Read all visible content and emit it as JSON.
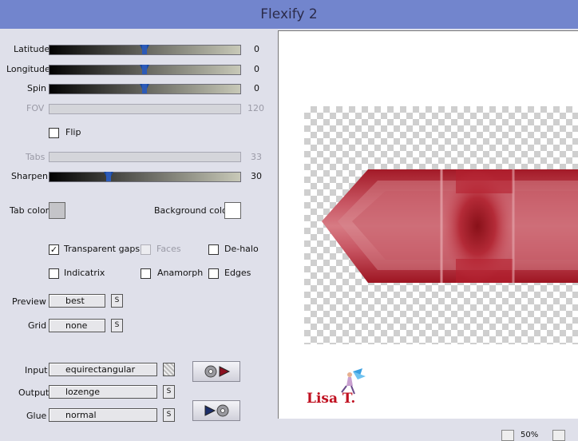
{
  "window": {
    "title": "Flexify 2"
  },
  "sliders": {
    "latitude": {
      "label": "Latitude",
      "value": "0",
      "position": 0.5
    },
    "longitude": {
      "label": "Longitude",
      "value": "0",
      "position": 0.5
    },
    "spin": {
      "label": "Spin",
      "value": "0",
      "position": 0.5
    },
    "fov": {
      "label": "FOV",
      "value": "120"
    },
    "tabs": {
      "label": "Tabs",
      "value": "33"
    },
    "sharpen": {
      "label": "Sharpen",
      "value": "30",
      "position": 0.3
    }
  },
  "checkboxes": {
    "flip": {
      "label": "Flip",
      "checked": false
    },
    "transparent_gaps": {
      "label": "Transparent gaps",
      "checked": true
    },
    "faces": {
      "label": "Faces",
      "checked": false
    },
    "dehalo": {
      "label": "De-halo",
      "checked": false
    },
    "indicatrix": {
      "label": "Indicatrix",
      "checked": false
    },
    "anamorph": {
      "label": "Anamorph",
      "checked": false
    },
    "edges": {
      "label": "Edges",
      "checked": false
    }
  },
  "colors": {
    "tab_color_label": "Tab color",
    "tab_color": "#c4c4c8",
    "background_color_label": "Background color",
    "background_color": "#ffffff",
    "accent": "#7285cd",
    "shape": "#c0394a"
  },
  "fields": {
    "preview": {
      "label": "Preview",
      "value": "best"
    },
    "grid": {
      "label": "Grid",
      "value": "none"
    },
    "input": {
      "label": "Input",
      "value": "equirectangular"
    },
    "output": {
      "label": "Output",
      "value": "lozenge"
    },
    "glue": {
      "label": "Glue",
      "value": "normal"
    }
  },
  "small_button_glyph": "S",
  "preview_panel": {
    "zoom": "50%",
    "watermark": "Lisa T."
  },
  "icons": {
    "forward": "disc-play-icon",
    "backward": "play-disc-icon"
  }
}
